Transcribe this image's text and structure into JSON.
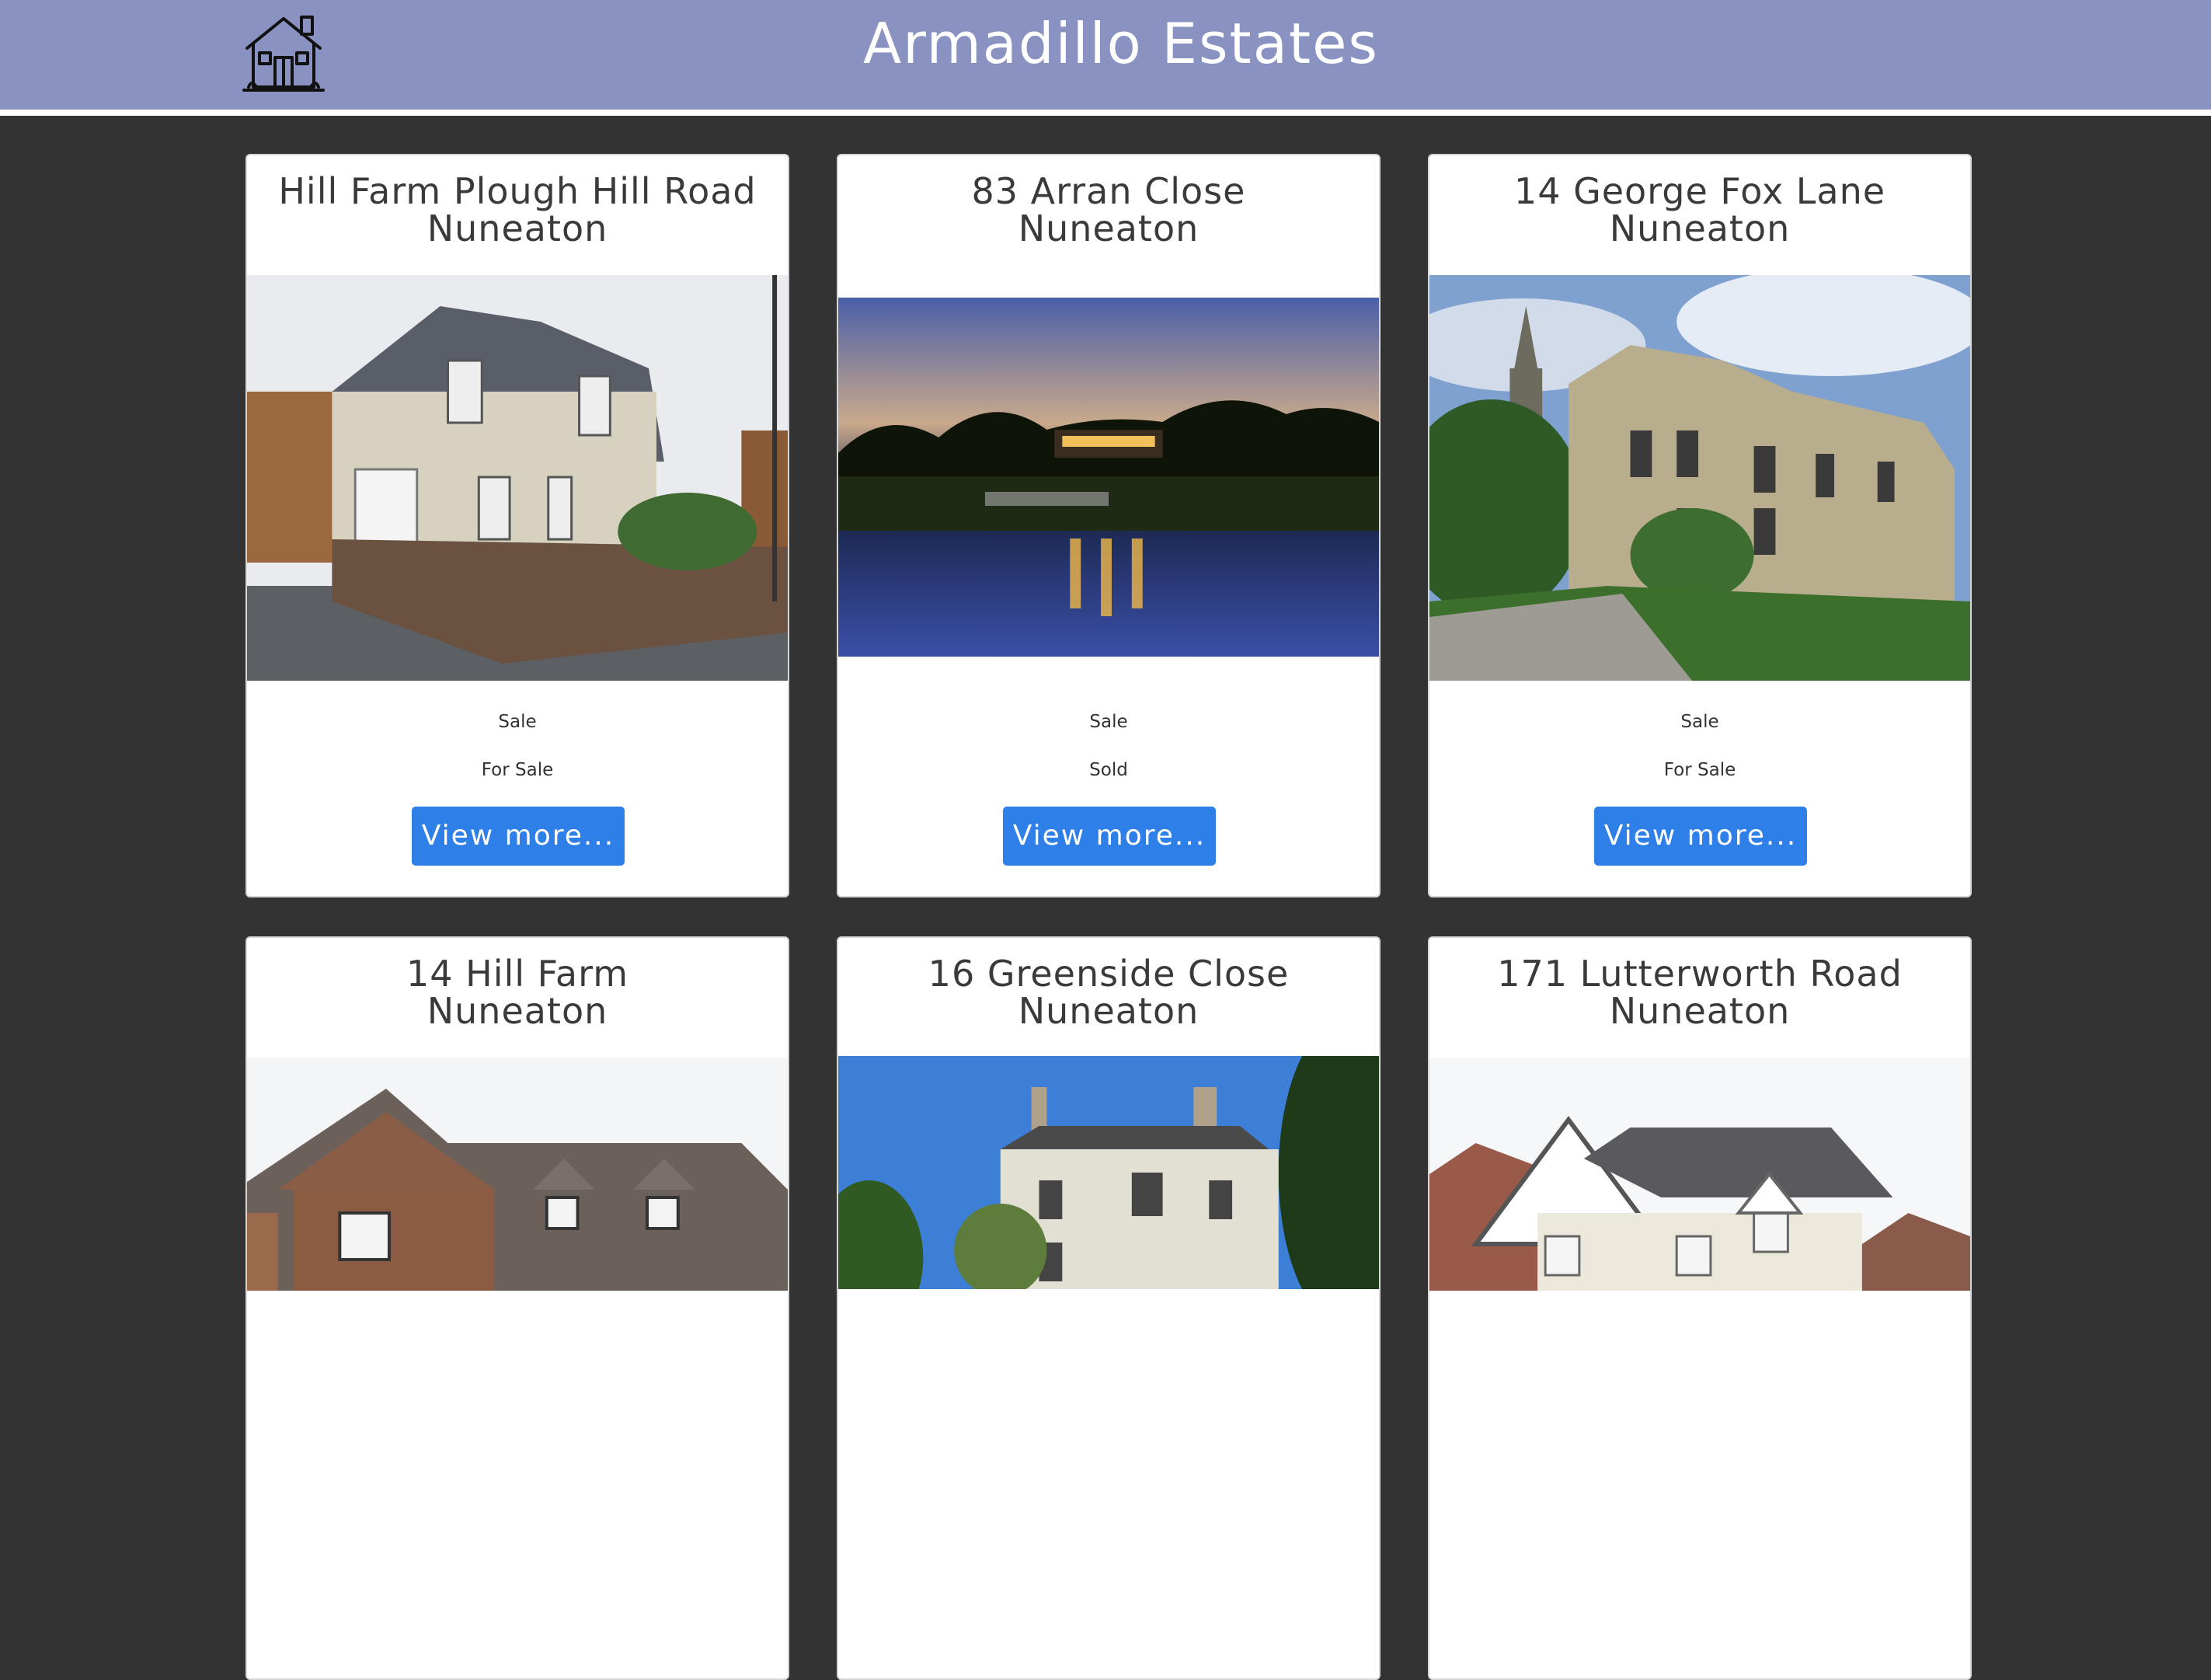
{
  "header": {
    "title": "Armadillo Estates",
    "logo_icon": "house-icon",
    "background": "#8992c0"
  },
  "cards": [
    {
      "street": "Hill Farm Plough Hill Road",
      "town": "Nuneaton",
      "type": "Sale",
      "status": "For Sale",
      "button": "View more..."
    },
    {
      "street": "83 Arran Close",
      "town": "Nuneaton",
      "type": "Sale",
      "status": "Sold",
      "button": "View more..."
    },
    {
      "street": "14 George Fox Lane",
      "town": "Nuneaton",
      "type": "Sale",
      "status": "For Sale",
      "button": "View more..."
    },
    {
      "street": "14 Hill Farm",
      "town": "Nuneaton"
    },
    {
      "street": "16 Greenside Close",
      "town": "Nuneaton"
    },
    {
      "street": "171 Lutterworth Road",
      "town": "Nuneaton"
    }
  ],
  "colors": {
    "page_background": "#333333",
    "button": "#2f7fe8"
  }
}
